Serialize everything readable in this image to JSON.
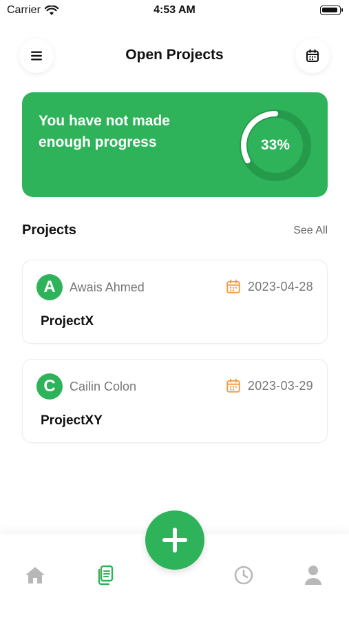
{
  "status_bar": {
    "carrier": "Carrier",
    "time": "4:53 AM"
  },
  "header": {
    "title": "Open Projects"
  },
  "progress_card": {
    "message": "You have not made enough progress",
    "percent_label": "33%",
    "progress_fraction": 0.33
  },
  "projects_section": {
    "title": "Projects",
    "see_all_label": "See All"
  },
  "projects": [
    {
      "initial": "A",
      "owner": "Awais Ahmed",
      "date": "2023-04-28",
      "name": "ProjectX"
    },
    {
      "initial": "C",
      "owner": "Cailin Colon",
      "date": "2023-03-29",
      "name": "ProjectXY"
    }
  ],
  "colors": {
    "accent": "#2fb35a",
    "date_icon": "#f0a04b",
    "nav_inactive": "#b8b8b8",
    "text_secondary": "#777777"
  },
  "icons": {
    "menu": "menu-icon",
    "calendar": "calendar-icon",
    "add": "plus-icon",
    "home": "home-icon",
    "projects": "documents-icon",
    "history": "clock-icon",
    "profile": "user-icon"
  }
}
